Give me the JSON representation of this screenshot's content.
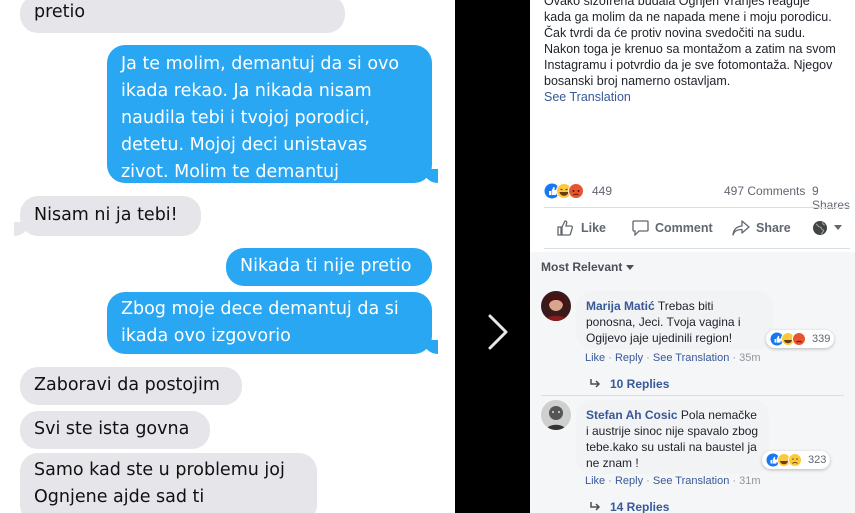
{
  "chat": {
    "messages": [
      {
        "side": "in",
        "text": "pretio"
      },
      {
        "side": "out",
        "text": "Ja te molim, demantuj da si ovo ikada rekao. Ja nikada nisam naudila tebi i tvojoj porodici, detetu. Mojoj deci unistavas zivot. Molim te demantuj"
      },
      {
        "side": "in",
        "text": "Nisam ni ja tebi!"
      },
      {
        "side": "out",
        "text": "Nikada ti nije pretio"
      },
      {
        "side": "out",
        "text": "Zbog moje dece demantuj da si ikada ovo izgovorio"
      },
      {
        "side": "in",
        "text": "Zaboravi da postojim"
      },
      {
        "side": "in",
        "text": "Svi ste ista govna"
      },
      {
        "side": "in",
        "text": "Samo kad ste u problemu joj Ognjene ajde sad ti"
      }
    ]
  },
  "colors": {
    "outgoing": "#29a7f2",
    "incoming": "#e5e5ea",
    "fb_link": "#385898"
  },
  "fb": {
    "post_lines": [
      "Ovako sizofrena budala Ognjen Vranjes reaguje",
      "kada ga molim da ne napada mene i moju porodicu.",
      "Čak tvrdi da će protiv novina svedočiti na sudu.",
      "Nakon toga je krenuo sa montažom a zatim na svom",
      "Instagramu i potvrdio da je sve fotomontaža. Njegov",
      "bosanski broj namerno ostavljam."
    ],
    "see_translation": "See Translation",
    "reactions_count": "449",
    "comments_count": "497 Comments",
    "shares_count": "9 Shares",
    "actions": {
      "like": "Like",
      "comment": "Comment",
      "share": "Share"
    },
    "sort_label": "Most Relevant",
    "comments": [
      {
        "author": "Marija Matić",
        "text": "Trebas biti ponosna, Jeci. Tvoja vagina i Ogijevo jaje ujedinili region!",
        "reactions": "339",
        "like": "Like",
        "reply": "Reply",
        "see_translation": "See Translation",
        "time": "35m",
        "replies": "10 Replies"
      },
      {
        "author": "Stefan Ah Cosic",
        "text": "Pola nemačke i austrije sinoc nije spavalo zbog tebe.kako su ustali na baustel ja ne znam !",
        "reactions": "323",
        "like": "Like",
        "reply": "Reply",
        "see_translation": "See Translation",
        "time": "31m",
        "replies": "14 Replies"
      }
    ]
  },
  "icons": [
    "chevron-right-icon",
    "like-icon",
    "comment-icon",
    "share-icon",
    "globe-icon",
    "caret-down-icon",
    "reply-arrow-icon",
    "reaction-like-icon",
    "reaction-haha-icon",
    "reaction-angry-icon",
    "reaction-sad-icon"
  ]
}
